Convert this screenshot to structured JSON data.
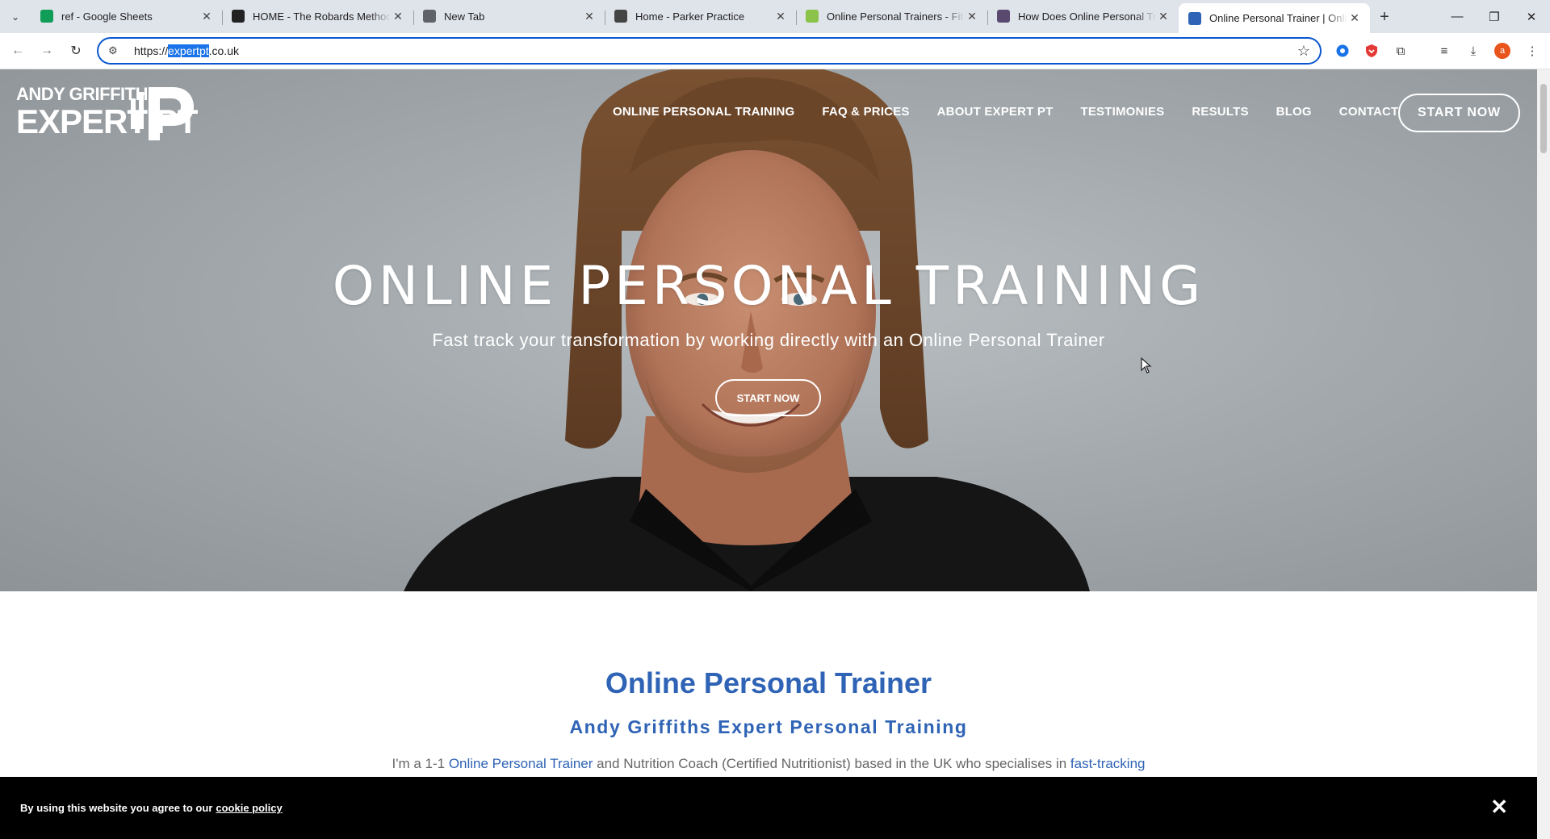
{
  "browser": {
    "tabs": [
      {
        "title": "ref - Google Sheets",
        "favicon": "sheets-icon",
        "color": "#0f9d58"
      },
      {
        "title": "HOME - The Robards Method",
        "favicon": "trm-icon",
        "color": "#222222"
      },
      {
        "title": "New Tab",
        "favicon": "chrome-icon",
        "color": "#5f6368"
      },
      {
        "title": "Home - Parker Practice",
        "favicon": "parker-icon",
        "color": "#444444"
      },
      {
        "title": "Online Personal Trainers - Fitne",
        "favicon": "fitness-icon",
        "color": "#8bc34a"
      },
      {
        "title": "How Does Online Personal Trai",
        "favicon": "l-icon",
        "color": "#5b4a6f"
      },
      {
        "title": "Online Personal Trainer | Online",
        "favicon": "expertpt-icon",
        "color": "#2f63b5"
      }
    ],
    "url_prefix": "https://",
    "url_highlight": "expertpt",
    "url_suffix": ".co.uk",
    "profile_initial": "a"
  },
  "site": {
    "logo_line1": "ANDY GRIFFITHS",
    "logo_line2": "EXPERT PT",
    "nav": [
      "ONLINE PERSONAL TRAINING",
      "FAQ & PRICES",
      "ABOUT EXPERT PT",
      "TESTIMONIES",
      "RESULTS",
      "BLOG",
      "CONTACT"
    ],
    "nav_cta": "START NOW",
    "hero_title": "ONLINE PERSONAL TRAINING",
    "hero_subtitle": "Fast track your transformation by working directly with an Online Personal Trainer",
    "hero_cta": "START NOW",
    "section_title": "Online Personal Trainer",
    "section_subtitle": "Andy Griffiths Expert Personal Training",
    "intro_1": "I'm a 1-1 ",
    "intro_link1": "Online Personal Trainer",
    "intro_2": " and Nutrition Coach (Certified Nutritionist) based in the UK who specialises in ",
    "intro_link2": "fast-tracking"
  },
  "cookie": {
    "text": "By using this website you agree to our",
    "link": "cookie policy",
    "close": "✕"
  },
  "colors": {
    "accent_blue": "#2f63b5",
    "omnibox_border": "#0b57d0"
  }
}
